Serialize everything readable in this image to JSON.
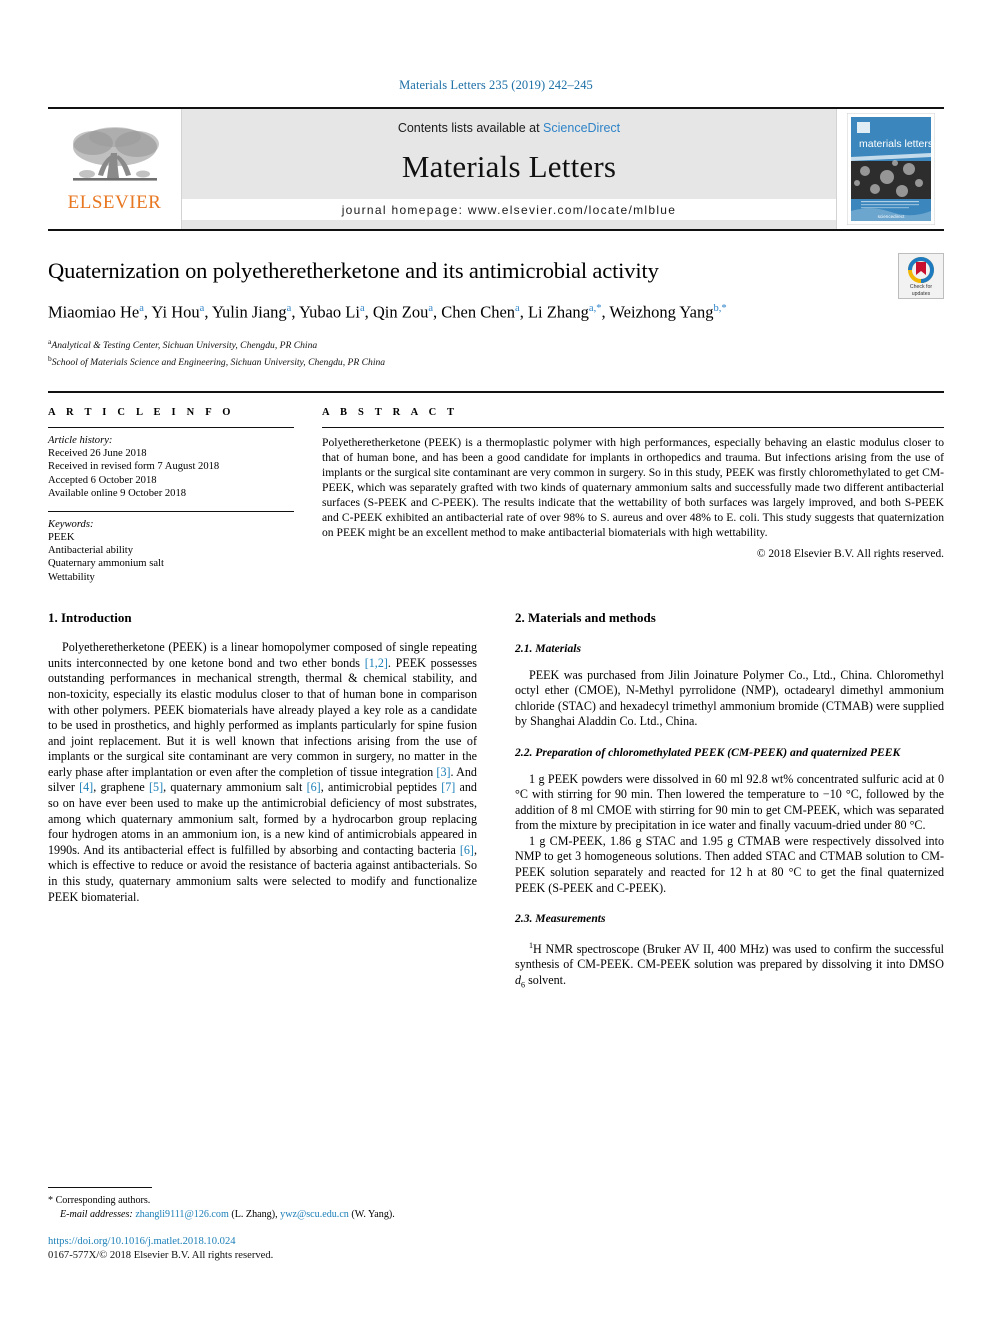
{
  "running_head": "Materials Letters 235 (2019) 242–245",
  "masthead": {
    "publisher_name": "ELSEVIER",
    "contents_prefix": "Contents lists available at ",
    "sciencedirect": "ScienceDirect",
    "journal_name": "Materials Letters",
    "homepage": "journal homepage: www.elsevier.com/locate/mlblue",
    "cover_title": "materials letters",
    "cover_footer": "sciencedirect",
    "accent_blue": "#2e83c8",
    "elsevier_orange": "#E87722",
    "cover_blue": "#3b87bd"
  },
  "title": "Quaternization on polyetheretherketone and its antimicrobial activity",
  "crossmark": {
    "line1": "Check for",
    "line2": "updates"
  },
  "authors": [
    {
      "name": "Miaomiao He",
      "sup": "a"
    },
    {
      "name": "Yi Hou",
      "sup": "a"
    },
    {
      "name": "Yulin Jiang",
      "sup": "a"
    },
    {
      "name": "Yubao Li",
      "sup": "a"
    },
    {
      "name": "Qin Zou",
      "sup": "a"
    },
    {
      "name": "Chen Chen",
      "sup": "a"
    },
    {
      "name": "Li Zhang",
      "sup": "a,*"
    },
    {
      "name": "Weizhong Yang",
      "sup": "b,*"
    }
  ],
  "affiliations": [
    {
      "mark": "a",
      "text": "Analytical & Testing Center, Sichuan University, Chengdu, PR China"
    },
    {
      "mark": "b",
      "text": "School of Materials Science and Engineering, Sichuan University, Chengdu, PR China"
    }
  ],
  "article_info": {
    "label": "A R T I C L E  I N F O",
    "history_head": "Article history:",
    "history": [
      "Received 26 June 2018",
      "Received in revised form 7 August 2018",
      "Accepted 6 October 2018",
      "Available online 9 October 2018"
    ],
    "keywords_head": "Keywords:",
    "keywords": [
      "PEEK",
      "Antibacterial ability",
      "Quaternary ammonium salt",
      "Wettability"
    ]
  },
  "abstract": {
    "label": "A B S T R A C T",
    "text": "Polyetheretherketone (PEEK) is a thermoplastic polymer with high performances, especially behaving an elastic modulus closer to that of human bone, and has been a good candidate for implants in orthopedics and trauma. But infections arising from the use of implants or the surgical site contaminant are very common in surgery. So in this study, PEEK was firstly chloromethylated to get CM-PEEK, which was separately grafted with two kinds of quaternary ammonium salts and successfully made two different antibacterial surfaces (S-PEEK and C-PEEK). The results indicate that the wettability of both surfaces was largely improved, and both S-PEEK and C-PEEK exhibited an antibacterial rate of over 98% to S. aureus and over 48% to E. coli. This study suggests that quaternization on PEEK might be an excellent method to make antibacterial biomaterials with high wettability.",
    "copyright": "© 2018 Elsevier B.V. All rights reserved."
  },
  "sections": {
    "introduction": {
      "heading": "1. Introduction",
      "paragraph_parts": [
        {
          "t": "Polyetheretherketone (PEEK) is a linear homopolymer composed of single repeating units interconnected by one ketone bond and two ether bonds "
        },
        {
          "t": "[1,2]",
          "ref": true
        },
        {
          "t": ". PEEK possesses outstanding performances in mechanical strength, thermal & chemical stability, and non-toxicity, especially its elastic modulus closer to that of human bone in comparison with other polymers. PEEK biomaterials have already played a key role as a candidate to be used in prosthetics, and highly performed as implants particularly for spine fusion and joint replacement. But it is well known that infections arising from the use of implants or the surgical site contaminant are very common in surgery, no matter in the early phase after implantation or even after the completion of tissue integration "
        },
        {
          "t": "[3]",
          "ref": true
        },
        {
          "t": ". And silver "
        },
        {
          "t": "[4]",
          "ref": true
        },
        {
          "t": ", graphene "
        },
        {
          "t": "[5]",
          "ref": true
        },
        {
          "t": ", quaternary ammonium salt "
        },
        {
          "t": "[6]",
          "ref": true
        },
        {
          "t": ", antimicrobial peptides "
        },
        {
          "t": "[7]",
          "ref": true
        },
        {
          "t": " and so on have ever been used to make up the antimicrobial deficiency of most substrates, among which quaternary ammonium salt, formed by a hydrocarbon group replacing four hydrogen atoms in an ammonium ion, is a new kind of antimicrobials appeared in 1990s. And its antibacterial effect is fulfilled by absorbing and contacting bacteria "
        },
        {
          "t": "[6]",
          "ref": true
        },
        {
          "t": ", which is effective to reduce or avoid the resistance of bacteria against antibacterials. So in this study, quaternary ammonium salts were selected to modify and functionalize PEEK biomaterial."
        }
      ]
    },
    "materials_methods": {
      "heading": "2. Materials and methods",
      "sub_materials": {
        "heading": "2.1. Materials",
        "paragraph": "PEEK was purchased from Jilin Joinature Polymer Co., Ltd., China. Chloromethyl octyl ether (CMOE), N-Methyl pyrrolidone (NMP), octadearyl dimethyl ammonium chloride (STAC) and hexadecyl trimethyl ammonium bromide (CTMAB) were supplied by Shanghai Aladdin Co. Ltd., China."
      },
      "sub_preparation": {
        "heading": "2.2. Preparation of chloromethylated PEEK (CM-PEEK) and quaternized PEEK",
        "paragraph1": "1 g PEEK powders were dissolved in 60 ml 92.8 wt% concentrated sulfuric acid at 0 °C with stirring for 90 min. Then lowered the temperature to −10 °C, followed by the addition of 8 ml CMOE with stirring for 90 min to get CM-PEEK, which was separated from the mixture by precipitation in ice water and finally vacuum-dried under 80 °C.",
        "paragraph2": "1 g CM-PEEK, 1.86 g STAC and 1.95 g CTMAB were respectively dissolved into NMP to get 3 homogeneous solutions. Then added STAC and CTMAB solution to CM-PEEK solution separately and reacted for 12 h at 80 °C to get the final quaternized PEEK (S-PEEK and C-PEEK)."
      },
      "sub_measurements": {
        "heading": "2.3. Measurements",
        "paragraph_pre": "H NMR spectroscope (Bruker AV II, 400 MHz) was used to confirm the successful synthesis of CM-PEEK. CM-PEEK solution was prepared by dissolving it into DMSO ",
        "paragraph_sup": "1",
        "paragraph_d": "d",
        "paragraph_sub": "6",
        "paragraph_post": " solvent."
      }
    }
  },
  "footer": {
    "corresponding": "* Corresponding authors.",
    "email_label": "E-mail addresses:",
    "email1": "zhangli9111@126.com",
    "email1_owner": "(L. Zhang),",
    "email2": "ywz@scu.edu.cn",
    "email2_owner": "(W. Yang).",
    "doi": "https://doi.org/10.1016/j.matlet.2018.10.024",
    "issn": "0167-577X/© 2018 Elsevier B.V. All rights reserved."
  }
}
